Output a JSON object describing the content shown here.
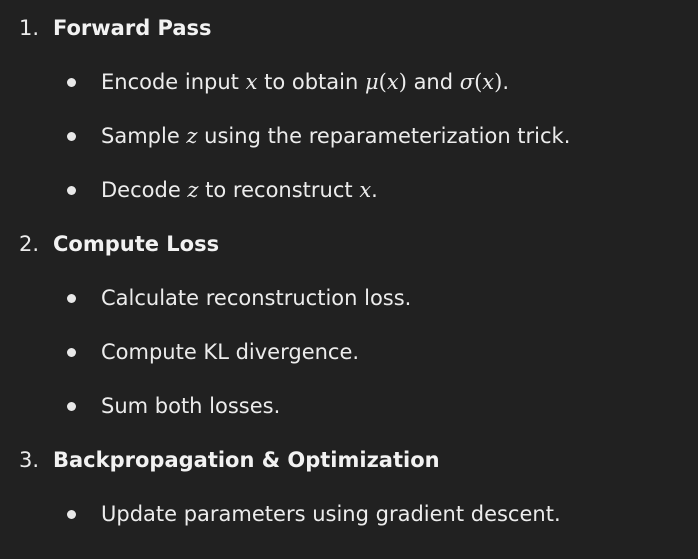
{
  "steps": [
    {
      "number": "1.",
      "title": "Forward Pass",
      "bullets": [
        {
          "pre": "Encode input ",
          "m1": "x",
          "mid": " to obtain ",
          "m2a": "μ",
          "m2b": "(",
          "m2c": "x",
          "m2d": ")",
          "mid2": " and ",
          "m3a": "σ",
          "m3b": "(",
          "m3c": "x",
          "m3d": ")",
          "post": "."
        },
        {
          "pre": "Sample ",
          "m1": "z",
          "post": " using the reparameterization trick."
        },
        {
          "pre": "Decode ",
          "m1": "z",
          "mid": " to reconstruct ",
          "m2": "x",
          "post": "."
        }
      ]
    },
    {
      "number": "2.",
      "title": "Compute Loss",
      "bullets": [
        {
          "text": "Calculate reconstruction loss."
        },
        {
          "text": "Compute KL divergence."
        },
        {
          "text": "Sum both losses."
        }
      ]
    },
    {
      "number": "3.",
      "title": "Backpropagation & Optimization",
      "bullets": [
        {
          "text": "Update parameters using gradient descent."
        }
      ]
    }
  ]
}
